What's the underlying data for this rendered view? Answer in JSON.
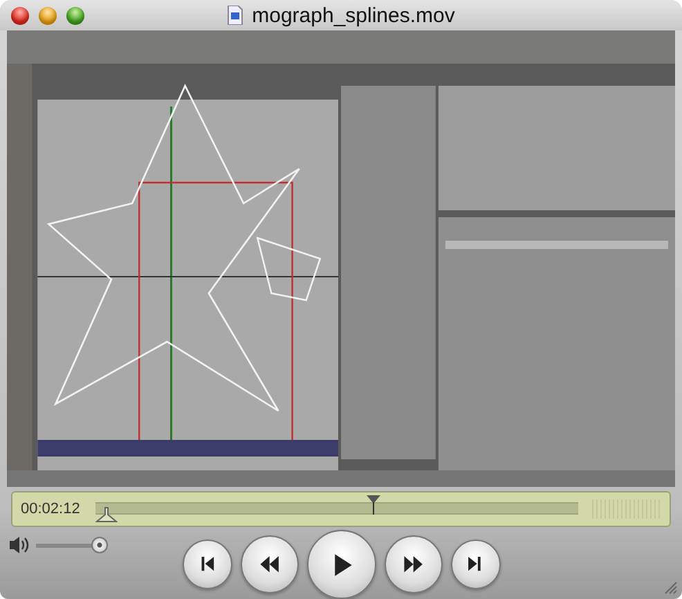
{
  "window": {
    "title": "mograph_splines.mov"
  },
  "timeline": {
    "time": "00:02:12",
    "level": 0.575
  },
  "volume": {
    "level": 0.95
  },
  "buttons": [
    {
      "kind": "start"
    },
    {
      "kind": "rewind"
    },
    {
      "kind": "play"
    },
    {
      "kind": "forward"
    },
    {
      "kind": "end"
    }
  ]
}
